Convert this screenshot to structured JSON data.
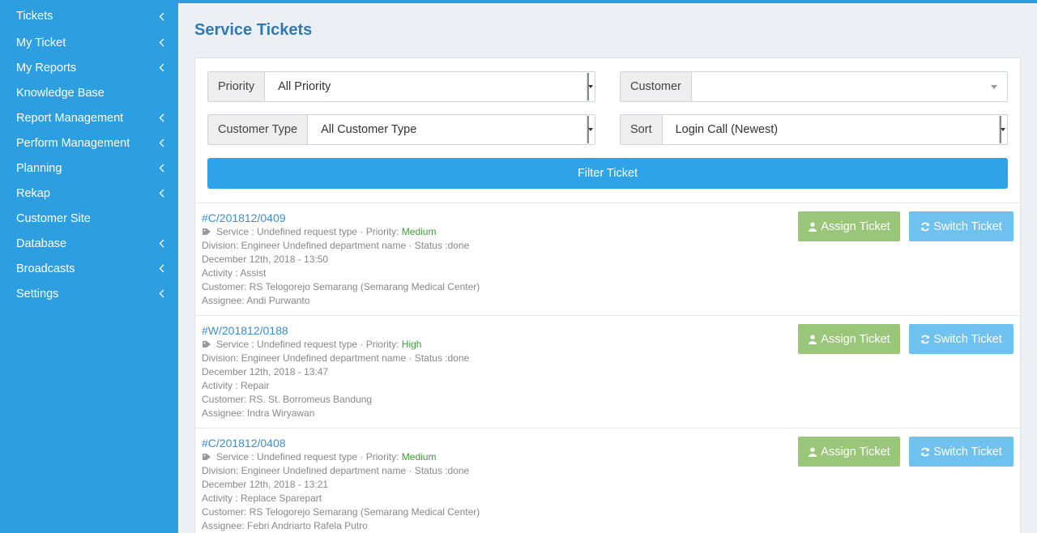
{
  "sidebar": {
    "items": [
      {
        "label": "Tickets",
        "has_children": true
      },
      {
        "label": "My Ticket",
        "has_children": true
      },
      {
        "label": "My Reports",
        "has_children": true
      },
      {
        "label": "Knowledge Base",
        "has_children": false
      },
      {
        "label": "Report Management",
        "has_children": true
      },
      {
        "label": "Perform Management",
        "has_children": true
      },
      {
        "label": "Planning",
        "has_children": true
      },
      {
        "label": "Rekap",
        "has_children": true
      },
      {
        "label": "Customer Site",
        "has_children": false
      },
      {
        "label": "Database",
        "has_children": true
      },
      {
        "label": "Broadcasts",
        "has_children": true
      },
      {
        "label": "Settings",
        "has_children": true
      }
    ]
  },
  "page": {
    "title": "Service Tickets"
  },
  "filters": {
    "priority": {
      "label": "Priority",
      "value": "All Priority"
    },
    "customer": {
      "label": "Customer",
      "value": ""
    },
    "customer_type": {
      "label": "Customer Type",
      "value": "All Customer Type"
    },
    "sort": {
      "label": "Sort",
      "value": "Login Call (Newest)"
    },
    "button_label": "Filter Ticket"
  },
  "actions": {
    "assign_label": "Assign Ticket",
    "switch_label": "Switch Ticket"
  },
  "tickets": [
    {
      "id": "#C/201812/0409",
      "service_prefix": "Service : Undefined request type · Priority: ",
      "priority": "Medium",
      "division": "Division: Engineer Undefined department name · Status :done",
      "date": "December 12th, 2018 - 13:50",
      "activity": "Activity : Assist",
      "customer": "Customer: RS Telogorejo Semarang (Semarang Medical Center)",
      "assignee": "Assignee: Andi Purwanto"
    },
    {
      "id": "#W/201812/0188",
      "service_prefix": "Service : Undefined request type · Priority: ",
      "priority": "High",
      "division": "Division: Engineer Undefined department name · Status :done",
      "date": "December 12th, 2018 - 13:47",
      "activity": "Activity : Repair",
      "customer": "Customer: RS. St. Borromeus Bandung",
      "assignee": "Assignee: Indra Wiryawan"
    },
    {
      "id": "#C/201812/0408",
      "service_prefix": "Service : Undefined request type · Priority: ",
      "priority": "Medium",
      "division": "Division: Engineer Undefined department name · Status :done",
      "date": "December 12th, 2018 - 13:21",
      "activity": "Activity : Replace Sparepart",
      "customer": "Customer: RS Telogorejo Semarang (Semarang Medical Center)",
      "assignee": "Assignee: Febri Andriarto Rafela Putro"
    }
  ]
}
